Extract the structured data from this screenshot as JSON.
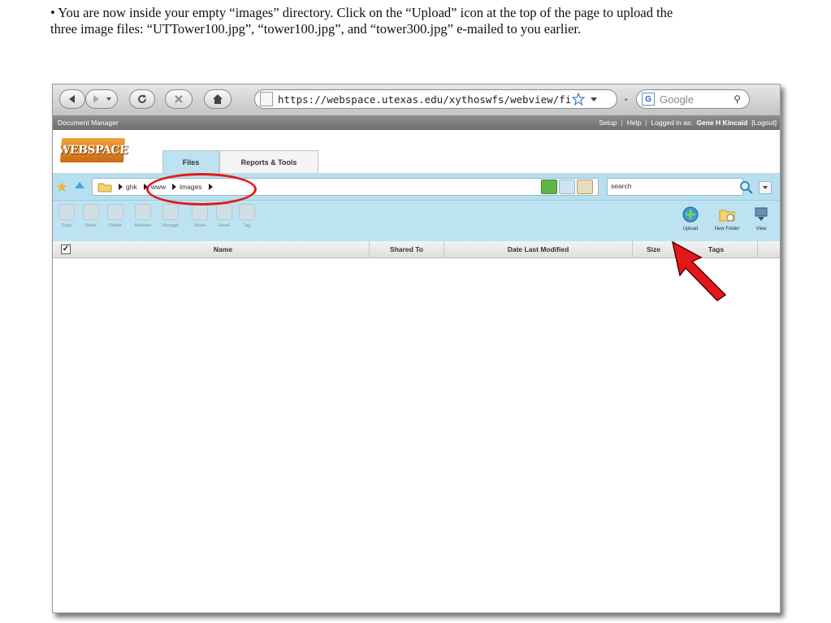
{
  "instruction": "• You are now inside your empty “images” directory. Click on the “Upload” icon at the top of the page to upload the three image files: “UTTower100.jpg”, “tower100.jpg”, and “tower300.jpg” e-mailed to you earlier.",
  "browser": {
    "url": "https://webspace.utexas.edu/xythoswfs/webview/fileManager",
    "search_placeholder": "Google"
  },
  "document_manager": {
    "title": "Document Manager",
    "setup": "Setup",
    "help": "Help",
    "logged_in_label": "Logged in as:",
    "user": "Gene H Kincaid",
    "logout": "[Logout]"
  },
  "app": {
    "logo": "WEBSPACE",
    "tabs": [
      {
        "label": "Files",
        "active": true
      },
      {
        "label": "Reports & Tools",
        "active": false
      }
    ]
  },
  "breadcrumb": [
    "ghk",
    "www",
    "images"
  ],
  "search": {
    "value": "search"
  },
  "actions": [
    "Copy",
    "Move",
    "Delete",
    "Rename",
    "Manage",
    "Share",
    "Email",
    "Tag"
  ],
  "right_actions": [
    "Upload",
    "New Folder",
    "View"
  ],
  "table": {
    "columns": [
      "Name",
      "Shared To",
      "Date Last Modified",
      "Size",
      "Tags"
    ]
  },
  "colors": {
    "annotation": "#e11919",
    "accent_blue": "#bde3f2"
  }
}
